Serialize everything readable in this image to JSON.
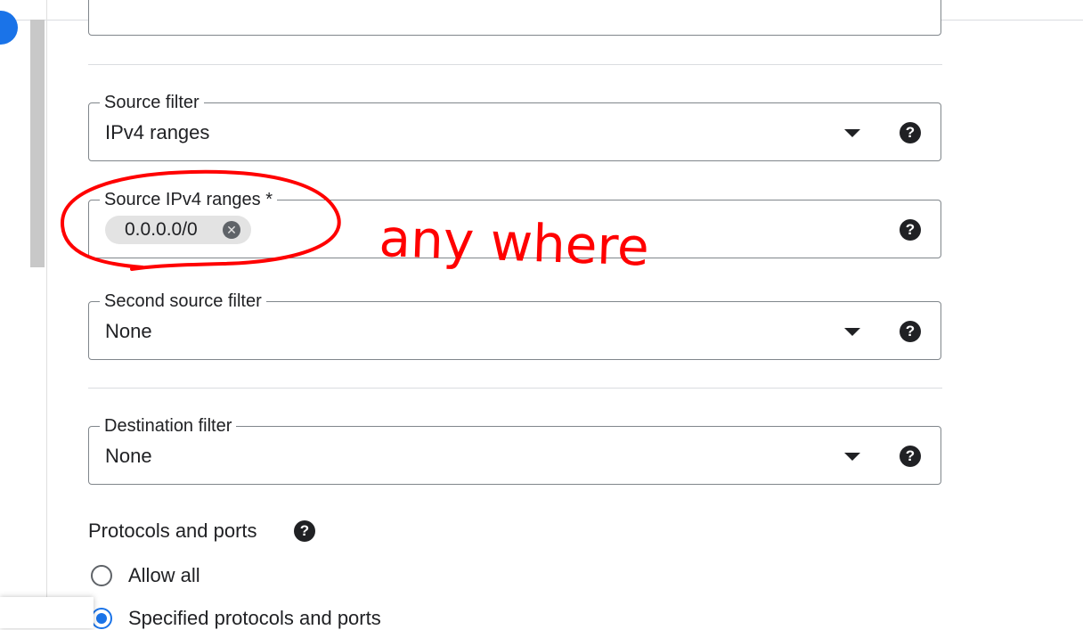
{
  "colors": {
    "accent": "#1a73e8",
    "annotation": "#ff0000",
    "border": "#80868b",
    "chip_bg": "#e3e3e3"
  },
  "source_filter": {
    "label": "Source filter",
    "value": "IPv4 ranges",
    "help": "?"
  },
  "source_ipv4_ranges": {
    "label": "Source IPv4 ranges *",
    "chip": "0.0.0.0/0",
    "chip_remove_icon": "cancel-icon",
    "help": "?"
  },
  "second_source_filter": {
    "label": "Second source filter",
    "value": "None",
    "help": "?"
  },
  "destination_filter": {
    "label": "Destination filter",
    "value": "None",
    "help": "?"
  },
  "protocols": {
    "title": "Protocols and ports",
    "help": "?",
    "options": [
      {
        "label": "Allow all",
        "checked": false
      },
      {
        "label": "Specified protocols and ports",
        "checked": true
      }
    ]
  },
  "annotation": {
    "text": "any where"
  }
}
